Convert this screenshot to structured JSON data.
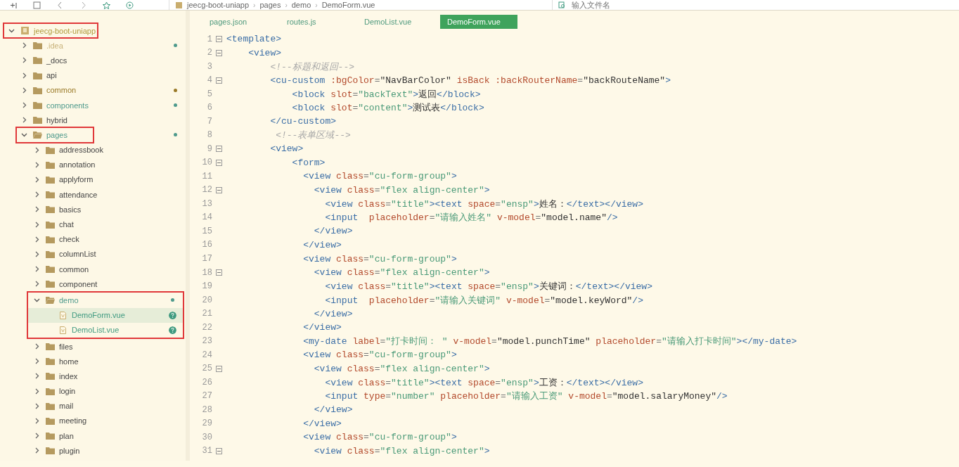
{
  "breadcrumb": [
    {
      "kind": "crumb",
      "label": "jeecg-boot-uniapp"
    },
    {
      "kind": "separator",
      "label": "›"
    },
    {
      "kind": "crumb",
      "label": "pages"
    },
    {
      "kind": "separator",
      "label": "›"
    },
    {
      "kind": "crumb",
      "label": "demo"
    },
    {
      "kind": "separator",
      "label": "›"
    },
    {
      "kind": "crumb",
      "label": "DemoForm.vue"
    }
  ],
  "file_search": {
    "placeholder": "输入文件名"
  },
  "tree": [
    {
      "label": "jeecg-boot-uniapp",
      "kind": "project",
      "expanded": true,
      "selected": false,
      "framed": true,
      "children": [
        {
          "label": ".idea",
          "kind": "folder",
          "expanded": false,
          "selected": false,
          "color": "#4e9a8c",
          "ignored": true
        },
        {
          "label": "_docs",
          "kind": "folder",
          "expanded": false,
          "selected": false
        },
        {
          "label": "api",
          "kind": "folder",
          "expanded": false,
          "selected": false
        },
        {
          "label": "common",
          "kind": "folder",
          "expanded": false,
          "selected": false,
          "color": "#9a7a28"
        },
        {
          "label": "components",
          "kind": "folder",
          "expanded": false,
          "selected": false,
          "color": "#4e9a8c"
        },
        {
          "label": "hybrid",
          "kind": "folder",
          "expanded": false,
          "selected": false
        },
        {
          "label": "pages",
          "kind": "folder",
          "expanded": true,
          "selected": false,
          "color": "#4e9a8c",
          "framed": true,
          "children": [
            {
              "label": "addressbook",
              "kind": "folder",
              "expanded": false,
              "selected": false
            },
            {
              "label": "annotation",
              "kind": "folder",
              "expanded": false,
              "selected": false
            },
            {
              "label": "applyform",
              "kind": "folder",
              "expanded": false,
              "selected": false
            },
            {
              "label": "attendance",
              "kind": "folder",
              "expanded": false,
              "selected": false
            },
            {
              "label": "basics",
              "kind": "folder",
              "expanded": false,
              "selected": false
            },
            {
              "label": "chat",
              "kind": "folder",
              "expanded": false,
              "selected": false
            },
            {
              "label": "check",
              "kind": "folder",
              "expanded": false,
              "selected": false
            },
            {
              "label": "columnList",
              "kind": "folder",
              "expanded": false,
              "selected": false
            },
            {
              "label": "common",
              "kind": "folder",
              "expanded": false,
              "selected": false
            },
            {
              "label": "component",
              "kind": "folder",
              "expanded": false,
              "selected": false
            },
            {
              "label": "demo",
              "kind": "folder",
              "expanded": true,
              "selected": false,
              "color": "#4e9a8c",
              "framed": true,
              "frame_includes_children": true,
              "children": [
                {
                  "label": "DemoForm.vue",
                  "kind": "file",
                  "color": "#3f9a80",
                  "untracked": true,
                  "selected": true
                },
                {
                  "label": "DemoList.vue",
                  "kind": "file",
                  "color": "#3f9a80",
                  "untracked": true,
                  "selected": false
                }
              ]
            },
            {
              "label": "files",
              "kind": "folder",
              "expanded": false,
              "selected": false
            },
            {
              "label": "home",
              "kind": "folder",
              "expanded": false,
              "selected": false
            },
            {
              "label": "index",
              "kind": "folder",
              "expanded": false,
              "selected": false
            },
            {
              "label": "login",
              "kind": "folder",
              "expanded": false,
              "selected": false
            },
            {
              "label": "mail",
              "kind": "folder",
              "expanded": false,
              "selected": false
            },
            {
              "label": "meeting",
              "kind": "folder",
              "expanded": false,
              "selected": false
            },
            {
              "label": "plan",
              "kind": "folder",
              "expanded": false,
              "selected": false
            },
            {
              "label": "plugin",
              "kind": "folder",
              "expanded": false,
              "selected": false
            }
          ]
        }
      ]
    }
  ],
  "tabs": [
    {
      "label": "pages.json",
      "selected": false
    },
    {
      "label": "routes.js",
      "selected": false
    },
    {
      "label": "DemoList.vue",
      "selected": false
    },
    {
      "label": "DemoForm.vue",
      "selected": true
    }
  ],
  "code": [
    {
      "number": "1",
      "fold": true,
      "tokens": [
        {
          "kind": "tag",
          "text": "<template>"
        }
      ]
    },
    {
      "number": "2",
      "fold": true,
      "tokens": [
        {
          "kind": "tag",
          "text": "    <view>"
        }
      ]
    },
    {
      "number": "3",
      "fold": false,
      "tokens": [
        {
          "kind": "comment",
          "text": "        <!--标题和返回-->"
        }
      ]
    },
    {
      "number": "4",
      "fold": true,
      "tokens": [
        {
          "kind": "tag",
          "text": "        <cu-custom"
        },
        {
          "kind": "attr",
          "text": " :bgColor"
        },
        {
          "kind": "eq",
          "text": "="
        },
        {
          "kind": "plain",
          "text": "\"NavBarColor\""
        },
        {
          "kind": "attr",
          "text": " isBack :backRouterName"
        },
        {
          "kind": "eq",
          "text": "="
        },
        {
          "kind": "plain",
          "text": "\"backRouteName\""
        },
        {
          "kind": "tag",
          "text": ">"
        }
      ]
    },
    {
      "number": "5",
      "fold": false,
      "tokens": [
        {
          "kind": "tag",
          "text": "            <block"
        },
        {
          "kind": "attr",
          "text": " slot"
        },
        {
          "kind": "eq",
          "text": "="
        },
        {
          "kind": "str",
          "text": "\"backText\""
        },
        {
          "kind": "tag",
          "text": ">"
        },
        {
          "kind": "plain",
          "text": "返回"
        },
        {
          "kind": "tag",
          "text": "</block>"
        }
      ]
    },
    {
      "number": "6",
      "fold": false,
      "tokens": [
        {
          "kind": "tag",
          "text": "            <block"
        },
        {
          "kind": "attr",
          "text": " slot"
        },
        {
          "kind": "eq",
          "text": "="
        },
        {
          "kind": "str",
          "text": "\"content\""
        },
        {
          "kind": "tag",
          "text": ">"
        },
        {
          "kind": "plain",
          "text": "测试表"
        },
        {
          "kind": "tag",
          "text": "</block>"
        }
      ]
    },
    {
      "number": "7",
      "fold": false,
      "tokens": [
        {
          "kind": "tag",
          "text": "        </cu-custom>"
        }
      ]
    },
    {
      "number": "8",
      "fold": false,
      "tokens": [
        {
          "kind": "comment",
          "text": "         <!--表单区域-->"
        }
      ]
    },
    {
      "number": "9",
      "fold": true,
      "tokens": [
        {
          "kind": "tag",
          "text": "        <view>"
        }
      ]
    },
    {
      "number": "10",
      "fold": true,
      "tokens": [
        {
          "kind": "tag",
          "text": "            <form>"
        }
      ]
    },
    {
      "number": "11",
      "fold": false,
      "tokens": [
        {
          "kind": "tag",
          "text": "              <view"
        },
        {
          "kind": "attr",
          "text": " class"
        },
        {
          "kind": "eq",
          "text": "="
        },
        {
          "kind": "str",
          "text": "\"cu-form-group\""
        },
        {
          "kind": "tag",
          "text": ">"
        }
      ]
    },
    {
      "number": "12",
      "fold": true,
      "tokens": [
        {
          "kind": "tag",
          "text": "                <view"
        },
        {
          "kind": "attr",
          "text": " class"
        },
        {
          "kind": "eq",
          "text": "="
        },
        {
          "kind": "str",
          "text": "\"flex align-center\""
        },
        {
          "kind": "tag",
          "text": ">"
        }
      ]
    },
    {
      "number": "13",
      "fold": false,
      "tokens": [
        {
          "kind": "tag",
          "text": "                  <view"
        },
        {
          "kind": "attr",
          "text": " class"
        },
        {
          "kind": "eq",
          "text": "="
        },
        {
          "kind": "str",
          "text": "\"title\""
        },
        {
          "kind": "tag",
          "text": "><text"
        },
        {
          "kind": "attr",
          "text": " space"
        },
        {
          "kind": "eq",
          "text": "="
        },
        {
          "kind": "str",
          "text": "\"ensp\""
        },
        {
          "kind": "tag",
          "text": ">"
        },
        {
          "kind": "plain",
          "text": "姓名："
        },
        {
          "kind": "tag",
          "text": "</text></view>"
        }
      ]
    },
    {
      "number": "14",
      "fold": false,
      "tokens": [
        {
          "kind": "tag",
          "text": "                  <input"
        },
        {
          "kind": "attr",
          "text": "  placeholder"
        },
        {
          "kind": "eq",
          "text": "="
        },
        {
          "kind": "str",
          "text": "\"请输入姓名\""
        },
        {
          "kind": "attr",
          "text": " v-model"
        },
        {
          "kind": "eq",
          "text": "="
        },
        {
          "kind": "plain",
          "text": "\"model.name\""
        },
        {
          "kind": "tag",
          "text": "/>"
        }
      ]
    },
    {
      "number": "15",
      "fold": false,
      "tokens": [
        {
          "kind": "tag",
          "text": "                </view>"
        }
      ]
    },
    {
      "number": "16",
      "fold": false,
      "tokens": [
        {
          "kind": "tag",
          "text": "              </view>"
        }
      ]
    },
    {
      "number": "17",
      "fold": false,
      "tokens": [
        {
          "kind": "tag",
          "text": "              <view"
        },
        {
          "kind": "attr",
          "text": " class"
        },
        {
          "kind": "eq",
          "text": "="
        },
        {
          "kind": "str",
          "text": "\"cu-form-group\""
        },
        {
          "kind": "tag",
          "text": ">"
        }
      ]
    },
    {
      "number": "18",
      "fold": true,
      "tokens": [
        {
          "kind": "tag",
          "text": "                <view"
        },
        {
          "kind": "attr",
          "text": " class"
        },
        {
          "kind": "eq",
          "text": "="
        },
        {
          "kind": "str",
          "text": "\"flex align-center\""
        },
        {
          "kind": "tag",
          "text": ">"
        }
      ]
    },
    {
      "number": "19",
      "fold": false,
      "tokens": [
        {
          "kind": "tag",
          "text": "                  <view"
        },
        {
          "kind": "attr",
          "text": " class"
        },
        {
          "kind": "eq",
          "text": "="
        },
        {
          "kind": "str",
          "text": "\"title\""
        },
        {
          "kind": "tag",
          "text": "><text"
        },
        {
          "kind": "attr",
          "text": " space"
        },
        {
          "kind": "eq",
          "text": "="
        },
        {
          "kind": "str",
          "text": "\"ensp\""
        },
        {
          "kind": "tag",
          "text": ">"
        },
        {
          "kind": "plain",
          "text": "关键词："
        },
        {
          "kind": "tag",
          "text": "</text></view>"
        }
      ]
    },
    {
      "number": "20",
      "fold": false,
      "tokens": [
        {
          "kind": "tag",
          "text": "                  <input"
        },
        {
          "kind": "attr",
          "text": "  placeholder"
        },
        {
          "kind": "eq",
          "text": "="
        },
        {
          "kind": "str",
          "text": "\"请输入关键词\""
        },
        {
          "kind": "attr",
          "text": " v-model"
        },
        {
          "kind": "eq",
          "text": "="
        },
        {
          "kind": "plain",
          "text": "\"model.keyWord\""
        },
        {
          "kind": "tag",
          "text": "/>"
        }
      ]
    },
    {
      "number": "21",
      "fold": false,
      "tokens": [
        {
          "kind": "tag",
          "text": "                </view>"
        }
      ]
    },
    {
      "number": "22",
      "fold": false,
      "tokens": [
        {
          "kind": "tag",
          "text": "              </view>"
        }
      ]
    },
    {
      "number": "23",
      "fold": false,
      "tokens": [
        {
          "kind": "tag",
          "text": "              <my-date"
        },
        {
          "kind": "attr",
          "text": " label"
        },
        {
          "kind": "eq",
          "text": "="
        },
        {
          "kind": "str",
          "text": "\"打卡时间： \""
        },
        {
          "kind": "attr",
          "text": " v-model"
        },
        {
          "kind": "eq",
          "text": "="
        },
        {
          "kind": "plain",
          "text": "\"model.punchTime\""
        },
        {
          "kind": "attr",
          "text": " placeholder"
        },
        {
          "kind": "eq",
          "text": "="
        },
        {
          "kind": "str",
          "text": "\"请输入打卡时间\""
        },
        {
          "kind": "tag",
          "text": "></my-date>"
        }
      ]
    },
    {
      "number": "24",
      "fold": false,
      "tokens": [
        {
          "kind": "tag",
          "text": "              <view"
        },
        {
          "kind": "attr",
          "text": " class"
        },
        {
          "kind": "eq",
          "text": "="
        },
        {
          "kind": "str",
          "text": "\"cu-form-group\""
        },
        {
          "kind": "tag",
          "text": ">"
        }
      ]
    },
    {
      "number": "25",
      "fold": true,
      "tokens": [
        {
          "kind": "tag",
          "text": "                <view"
        },
        {
          "kind": "attr",
          "text": " class"
        },
        {
          "kind": "eq",
          "text": "="
        },
        {
          "kind": "str",
          "text": "\"flex align-center\""
        },
        {
          "kind": "tag",
          "text": ">"
        }
      ]
    },
    {
      "number": "26",
      "fold": false,
      "tokens": [
        {
          "kind": "tag",
          "text": "                  <view"
        },
        {
          "kind": "attr",
          "text": " class"
        },
        {
          "kind": "eq",
          "text": "="
        },
        {
          "kind": "str",
          "text": "\"title\""
        },
        {
          "kind": "tag",
          "text": "><text"
        },
        {
          "kind": "attr",
          "text": " space"
        },
        {
          "kind": "eq",
          "text": "="
        },
        {
          "kind": "str",
          "text": "\"ensp\""
        },
        {
          "kind": "tag",
          "text": ">"
        },
        {
          "kind": "plain",
          "text": "工资："
        },
        {
          "kind": "tag",
          "text": "</text></view>"
        }
      ]
    },
    {
      "number": "27",
      "fold": false,
      "tokens": [
        {
          "kind": "tag",
          "text": "                  <input"
        },
        {
          "kind": "attr",
          "text": " type"
        },
        {
          "kind": "eq",
          "text": "="
        },
        {
          "kind": "str",
          "text": "\"number\""
        },
        {
          "kind": "attr",
          "text": " placeholder"
        },
        {
          "kind": "eq",
          "text": "="
        },
        {
          "kind": "str",
          "text": "\"请输入工资\""
        },
        {
          "kind": "attr",
          "text": " v-model"
        },
        {
          "kind": "eq",
          "text": "="
        },
        {
          "kind": "plain",
          "text": "\"model.salaryMoney\""
        },
        {
          "kind": "tag",
          "text": "/>"
        }
      ]
    },
    {
      "number": "28",
      "fold": false,
      "tokens": [
        {
          "kind": "tag",
          "text": "                </view>"
        }
      ]
    },
    {
      "number": "29",
      "fold": false,
      "tokens": [
        {
          "kind": "tag",
          "text": "              </view>"
        }
      ]
    },
    {
      "number": "30",
      "fold": false,
      "tokens": [
        {
          "kind": "tag",
          "text": "              <view"
        },
        {
          "kind": "attr",
          "text": " class"
        },
        {
          "kind": "eq",
          "text": "="
        },
        {
          "kind": "str",
          "text": "\"cu-form-group\""
        },
        {
          "kind": "tag",
          "text": ">"
        }
      ]
    },
    {
      "number": "31",
      "fold": true,
      "tokens": [
        {
          "kind": "tag",
          "text": "                <view"
        },
        {
          "kind": "attr",
          "text": " class"
        },
        {
          "kind": "eq",
          "text": "="
        },
        {
          "kind": "str",
          "text": "\"flex align-center\""
        },
        {
          "kind": "tag",
          "text": ">"
        }
      ]
    }
  ]
}
